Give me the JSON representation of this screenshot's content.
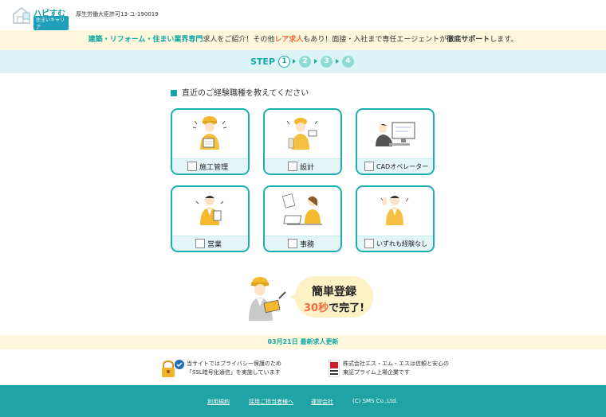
{
  "header": {
    "logo_text": "ハピすむ",
    "logo_sub": "住まいキャリア",
    "license": "厚生労働大臣許可13-ユ-190019"
  },
  "banner": {
    "part1": "建築・リフォーム・住まい業界専門",
    "part2": "求人をご紹介！その他",
    "part3": "レア求人",
    "part4": "もあり！面接・入社まで専任エージェントが",
    "part5": "徹底サポート",
    "part6": "します。"
  },
  "steps": {
    "label": "STEP",
    "items": [
      "1",
      "2",
      "3",
      "4"
    ],
    "current": 1
  },
  "question": "直近のご経験職種を教えてください",
  "options": [
    {
      "label": "施工管理"
    },
    {
      "label": "設計"
    },
    {
      "label": "CADオペレーター"
    },
    {
      "label": "営業"
    },
    {
      "label": "事務"
    },
    {
      "label": "いずれも経験なし"
    }
  ],
  "promo": {
    "line1": "簡単登録",
    "seconds": "30秒",
    "line2_rest": "で完了!"
  },
  "news": "03月21日 最新求人更新",
  "trust": {
    "privacy_l1": "当サイトではプライバシー保護のため",
    "privacy_l2": "「SSL暗号化通信」を実施しています",
    "company_l1": "株式会社エス・エム・エスは信頼と安心の",
    "company_l2": "東証プライム上場企業です"
  },
  "footer": {
    "links": [
      "利用規約",
      "採用ご担当者様へ",
      "運営会社"
    ],
    "copyright": "(C) SMS Co.,Ltd."
  },
  "colors": {
    "teal": "#14a8a8",
    "orange": "#f26b3a",
    "cream": "#fdf7dd",
    "light_teal": "#dcf4f6"
  }
}
